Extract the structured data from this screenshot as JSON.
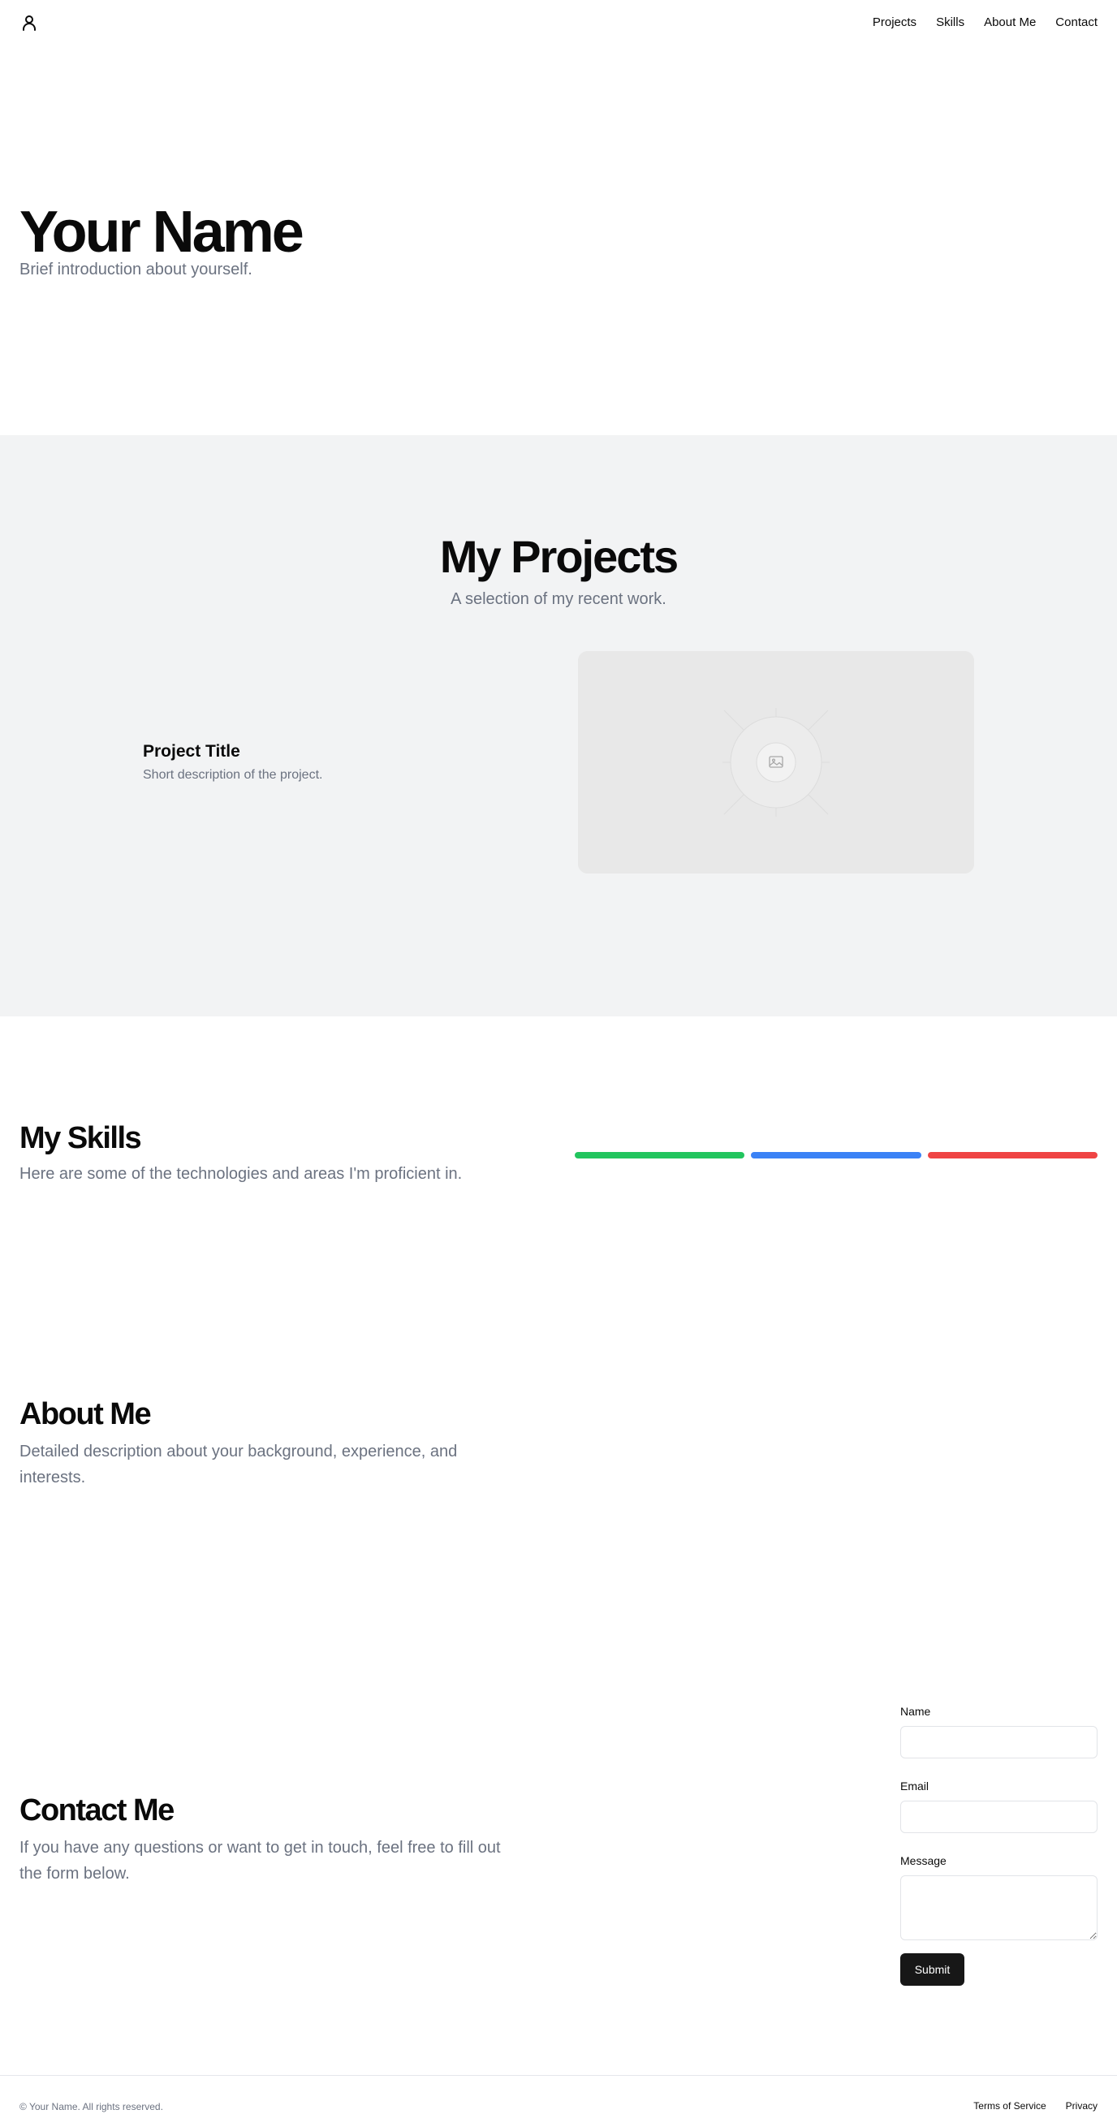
{
  "header": {
    "logo_icon": "user-icon",
    "nav": [
      {
        "label": "Projects"
      },
      {
        "label": "Skills"
      },
      {
        "label": "About Me"
      },
      {
        "label": "Contact"
      }
    ]
  },
  "hero": {
    "title": "Your Name",
    "intro": "Brief introduction about yourself."
  },
  "projects": {
    "title": "My Projects",
    "subtitle": "A selection of my recent work.",
    "items": [
      {
        "title": "Project Title",
        "description": "Short description of the project.",
        "image_icon": "image-placeholder-icon"
      }
    ]
  },
  "skills": {
    "title": "My Skills",
    "subtitle": "Here are some of the technologies and areas I'm proficient in.",
    "bars": [
      {
        "color": "#22c55e"
      },
      {
        "color": "#3b82f6"
      },
      {
        "color": "#ef4444"
      }
    ]
  },
  "about": {
    "title": "About Me",
    "description": "Detailed description about your background, experience, and interests."
  },
  "contact": {
    "title": "Contact Me",
    "description": "If you have any questions or want to get in touch, feel free to fill out the form below.",
    "form": {
      "name_label": "Name",
      "name_value": "",
      "email_label": "Email",
      "email_value": "",
      "message_label": "Message",
      "message_value": "",
      "submit_label": "Submit"
    }
  },
  "footer": {
    "copyright": "© Your Name. All rights reserved.",
    "links": [
      {
        "label": "Terms of Service"
      },
      {
        "label": "Privacy"
      }
    ]
  }
}
